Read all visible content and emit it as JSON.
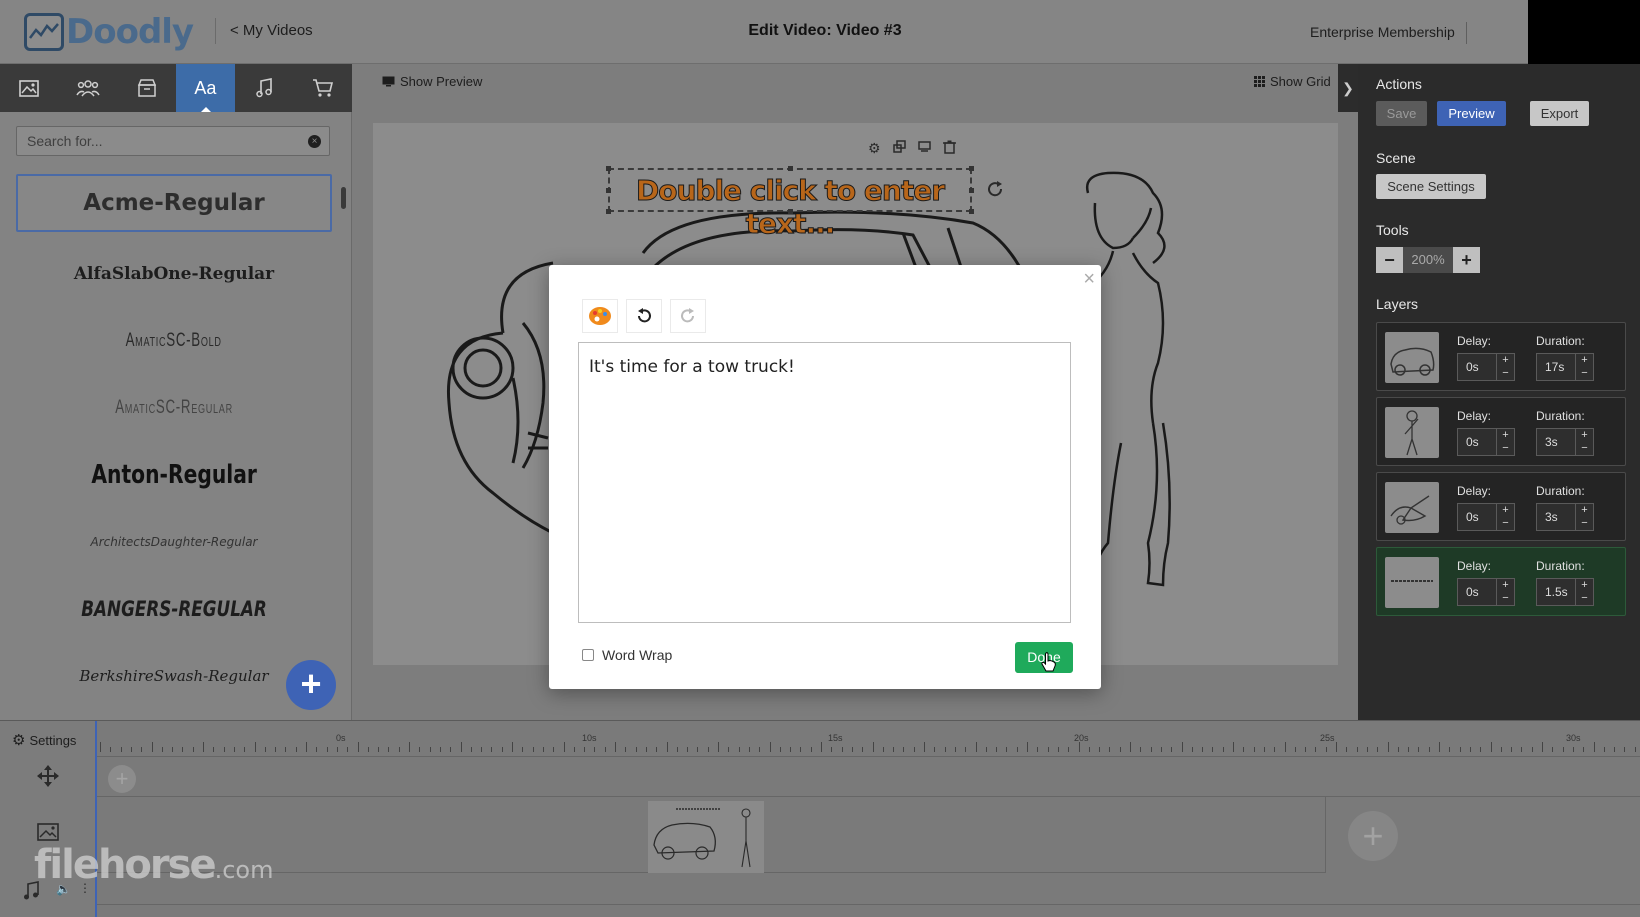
{
  "app": {
    "logo_text": "Doodly",
    "back_link": "< My Videos",
    "page_title": "Edit Video: Video #3",
    "membership": "Enterprise Membership"
  },
  "tool_tabs": [
    {
      "icon": "image-icon"
    },
    {
      "icon": "people-icon"
    },
    {
      "icon": "archive-icon"
    },
    {
      "icon": "font-icon",
      "label": "Aa",
      "active": true
    },
    {
      "icon": "music-icon"
    },
    {
      "icon": "cart-icon"
    }
  ],
  "left_panel": {
    "search_placeholder": "Search for...",
    "fonts": [
      "Acme-Regular",
      "AlfaSlabOne-Regular",
      "AmaticSC-Bold",
      "AmaticSC-Regular",
      "Anton-Regular",
      "ArchitectsDaughter-Regular",
      "BANGERS-REGULAR",
      "BerkshireSwash-Regular"
    ],
    "selected_font": "Acme-Regular",
    "add_label": "+"
  },
  "canvas": {
    "show_preview": "Show Preview",
    "show_grid": "Show Grid",
    "text_object": "Double click to enter text..."
  },
  "modal": {
    "text_value": "It's time for a tow truck!",
    "word_wrap_label": "Word Wrap",
    "word_wrap_checked": false,
    "done_label": "Done",
    "close_label": "×"
  },
  "right_panel": {
    "actions_heading": "Actions",
    "save_label": "Save",
    "preview_label": "Preview",
    "export_label": "Export",
    "scene_heading": "Scene",
    "scene_settings_label": "Scene Settings",
    "tools_heading": "Tools",
    "zoom_value": "200%",
    "layers_heading": "Layers",
    "delay_label": "Delay:",
    "duration_label": "Duration:",
    "layers": [
      {
        "delay": "0s",
        "duration": "17s",
        "active": false
      },
      {
        "delay": "0s",
        "duration": "3s",
        "active": false
      },
      {
        "delay": "0s",
        "duration": "3s",
        "active": false
      },
      {
        "delay": "0s",
        "duration": "1.5s",
        "active": true
      }
    ]
  },
  "timeline": {
    "settings_label": "Settings",
    "ticks": [
      "0s",
      "10s",
      "15s",
      "20s",
      "25s",
      "30s"
    ]
  },
  "watermark": {
    "main": "filehorse",
    "suffix": ".com"
  },
  "colors": {
    "accent_blue": "#3e63b5",
    "done_green": "#1faa5b",
    "active_layer": "#1e3a26",
    "text_object_orange": "#b8661a"
  }
}
